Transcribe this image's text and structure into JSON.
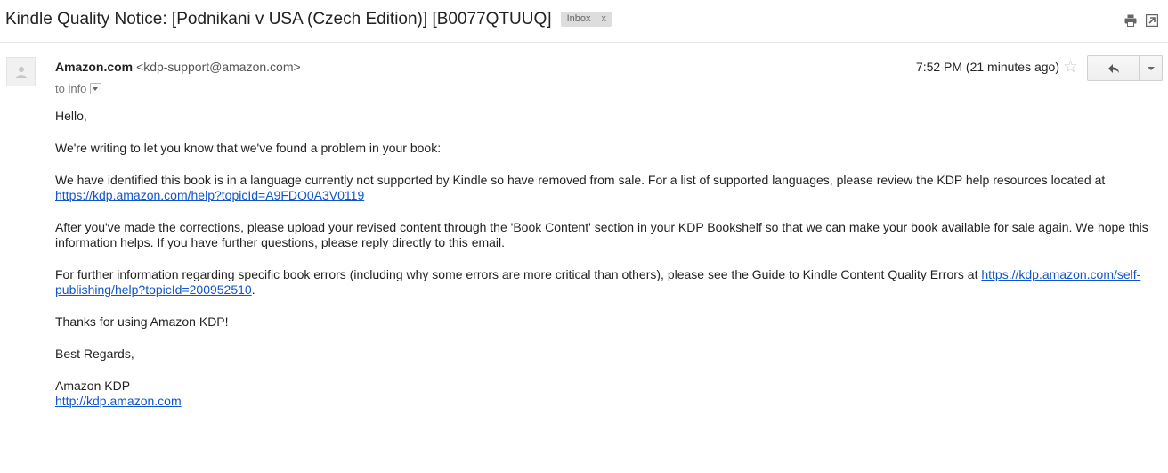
{
  "email": {
    "subject": "Kindle Quality Notice: [Podnikani v USA (Czech Edition)] [B0077QTUUQ]",
    "label": "Inbox",
    "label_remove": "x",
    "sender_name": "Amazon.com",
    "sender_email": "<kdp-support@amazon.com>",
    "to": "to info",
    "timestamp": "7:52 PM (21 minutes ago)",
    "star": "☆",
    "body": {
      "greeting": "Hello,",
      "p1": "We're writing to let you know that we've found a problem in  your book:",
      "p2_text": "We have identified this book is in a language currently not supported by Kindle so have removed from sale.  For a list of supported languages, please review the KDP help resources located at ",
      "p2_link": "https://kdp.amazon.com/help?topicId=A9FDO0A3V0119",
      "p3": "After you've made the corrections, please upload your revised content through the 'Book Content' section in your KDP Bookshelf so that we can make your book available for sale again. We hope this information helps. If you have further questions, please reply directly to this email.",
      "p4_text": "For further information regarding specific book errors (including why some errors are more critical than others), please see the Guide to Kindle Content Quality Errors at ",
      "p4_link": "https://kdp.amazon.com/self-publishing/help?topicId=200952510",
      "p4_end": ".",
      "thanks": "Thanks for using Amazon KDP!",
      "regards": "Best Regards,",
      "signature": "Amazon KDP",
      "signature_link": "http://kdp.amazon.com"
    }
  },
  "icons": {
    "print": "print-icon",
    "new_window": "new-window-icon",
    "reply": "reply-arrow-icon",
    "more": "chevron-down-icon",
    "avatar": "person-icon"
  }
}
